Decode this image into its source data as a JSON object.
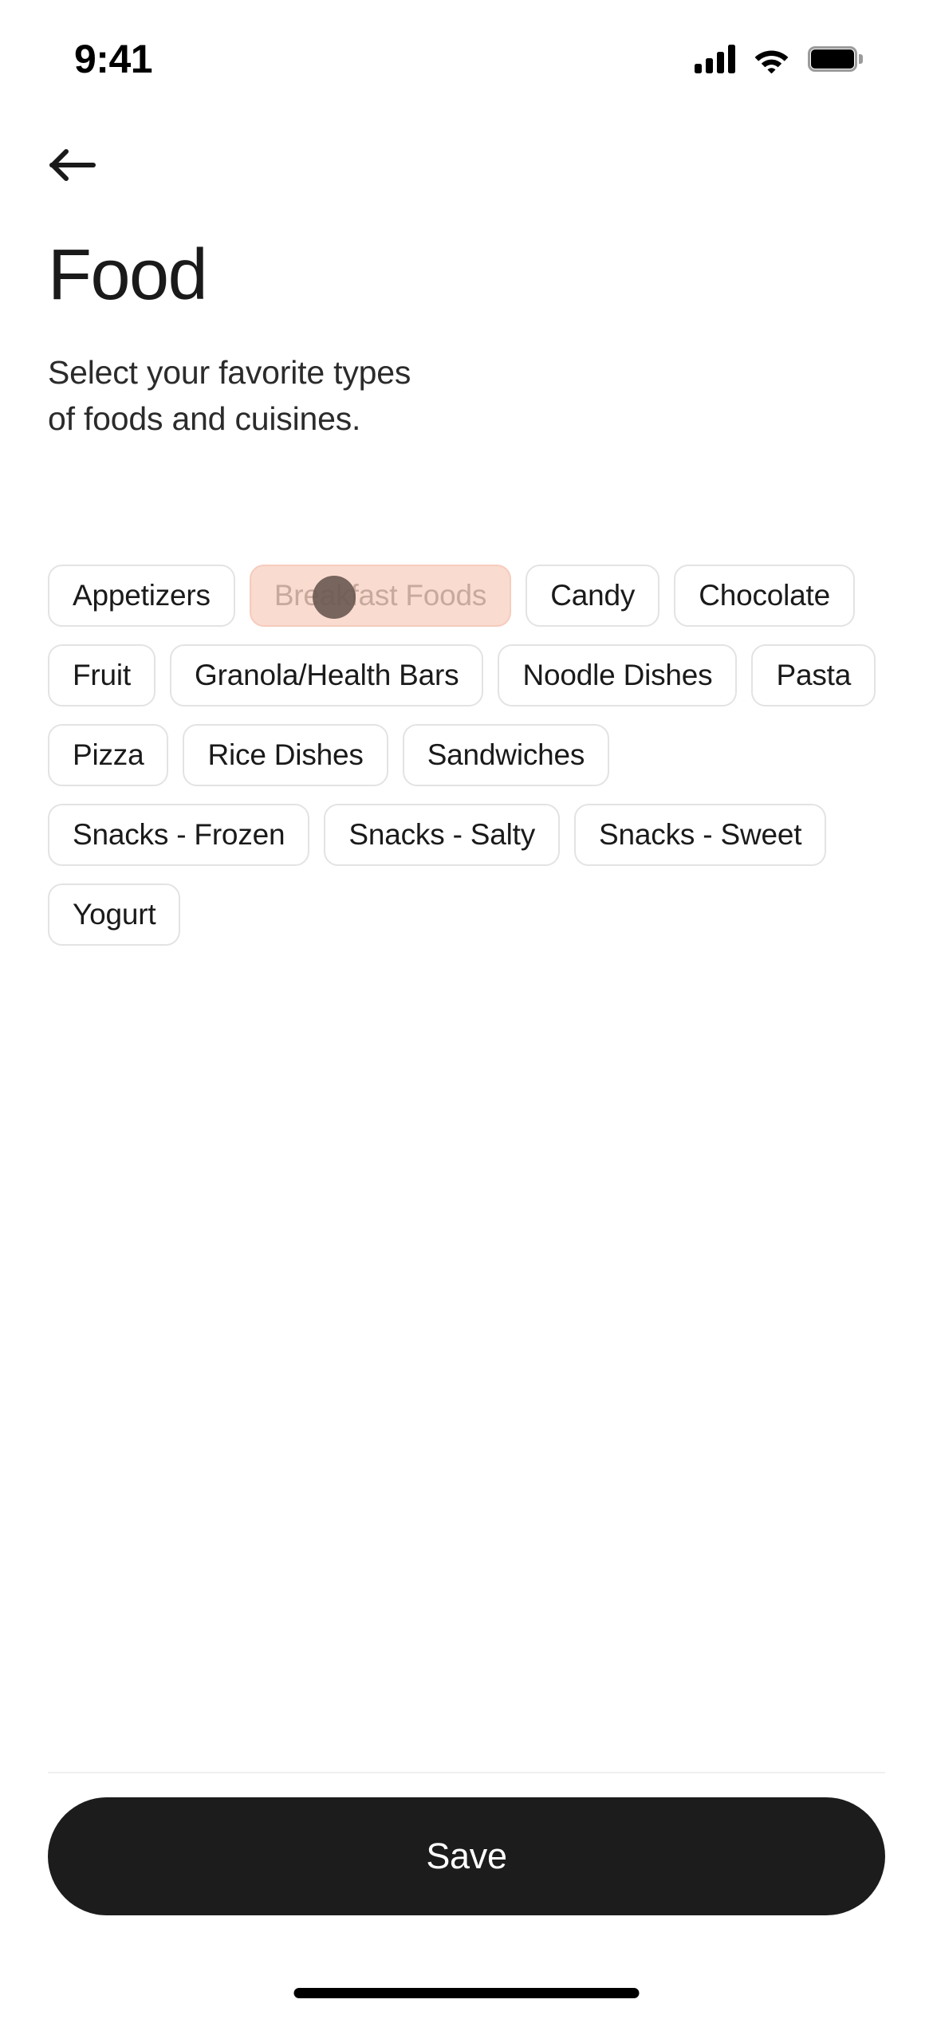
{
  "status_bar": {
    "time": "9:41",
    "signal_icon": "cellular-signal-icon",
    "wifi_icon": "wifi-icon",
    "battery_icon": "battery-full-icon"
  },
  "nav": {
    "back_icon": "arrow-left-icon",
    "back_label": "Back"
  },
  "header": {
    "title": "Food",
    "subtitle": "Select your favorite types of foods and cuisines."
  },
  "chips": [
    {
      "label": "Appetizers",
      "selected": false
    },
    {
      "label": "Breakfast Foods",
      "selected": true
    },
    {
      "label": "Candy",
      "selected": false
    },
    {
      "label": "Chocolate",
      "selected": false
    },
    {
      "label": "Fruit",
      "selected": false
    },
    {
      "label": "Granola/Health Bars",
      "selected": false
    },
    {
      "label": "Noodle Dishes",
      "selected": false
    },
    {
      "label": "Pasta",
      "selected": false
    },
    {
      "label": "Pizza",
      "selected": false
    },
    {
      "label": "Rice Dishes",
      "selected": false
    },
    {
      "label": "Sandwiches",
      "selected": false
    },
    {
      "label": "Snacks - Frozen",
      "selected": false
    },
    {
      "label": "Snacks - Salty",
      "selected": false
    },
    {
      "label": "Snacks - Sweet",
      "selected": false
    },
    {
      "label": "Yogurt",
      "selected": false
    }
  ],
  "footer": {
    "save_label": "Save"
  },
  "colors": {
    "selected_chip_background": "#fadbd0",
    "selected_chip_border": "#f6cbbc",
    "selected_chip_text": "#c8a99d",
    "chip_border": "#e3e3e3",
    "save_button_background": "#1c1c1c",
    "save_button_text": "#ffffff",
    "touch_indicator": "#6b5b54",
    "page_background": "#ffffff"
  },
  "touch_indicator": {
    "name": "touch-point-indicator",
    "on_chip": "Breakfast Foods"
  }
}
